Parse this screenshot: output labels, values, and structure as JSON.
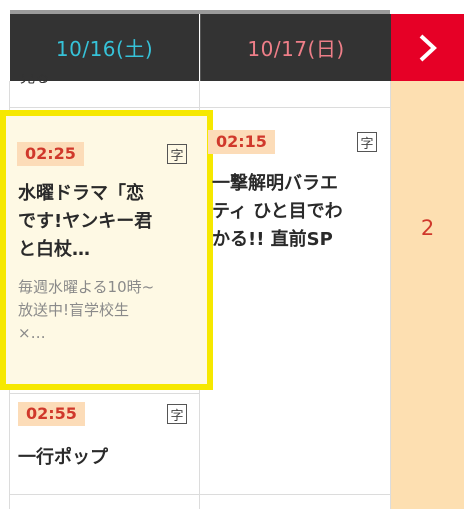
{
  "header": {
    "day1": "10/16(土)",
    "day2": "10/17(日)",
    "day1_color": "#36c2d8",
    "day2_color": "#ee7e88",
    "next_icon": "chevron-right-icon",
    "next_bg": "#e60026"
  },
  "column1": {
    "peek_text": "見る",
    "program1": {
      "time": "02:25",
      "subtitle_badge": "字",
      "title": "水曜ドラマ「恋です!ヤンキー君と白杖…",
      "title_lines": [
        "水曜ドラマ「恋",
        "です!ヤンキー君",
        "と白杖…"
      ],
      "desc_lines": [
        "毎週水曜よる10時~",
        "放送中!盲学校生",
        "×…"
      ]
    },
    "program2": {
      "time": "02:55",
      "subtitle_badge": "字",
      "title": "一行ポップ"
    }
  },
  "column2": {
    "program1": {
      "time": "02:15",
      "subtitle_badge": "字",
      "title_lines": [
        "一撃解明バラエ",
        "ティ ひと目でわ",
        "かる!! 直前SP"
      ]
    }
  },
  "column3": {
    "count": "2"
  },
  "colors": {
    "header_bg": "#333333",
    "highlight_border": "#f6e800",
    "time_text": "#d0382b",
    "time_bg": "#fcdcb8",
    "side_column_bg": "#fddfb1"
  }
}
